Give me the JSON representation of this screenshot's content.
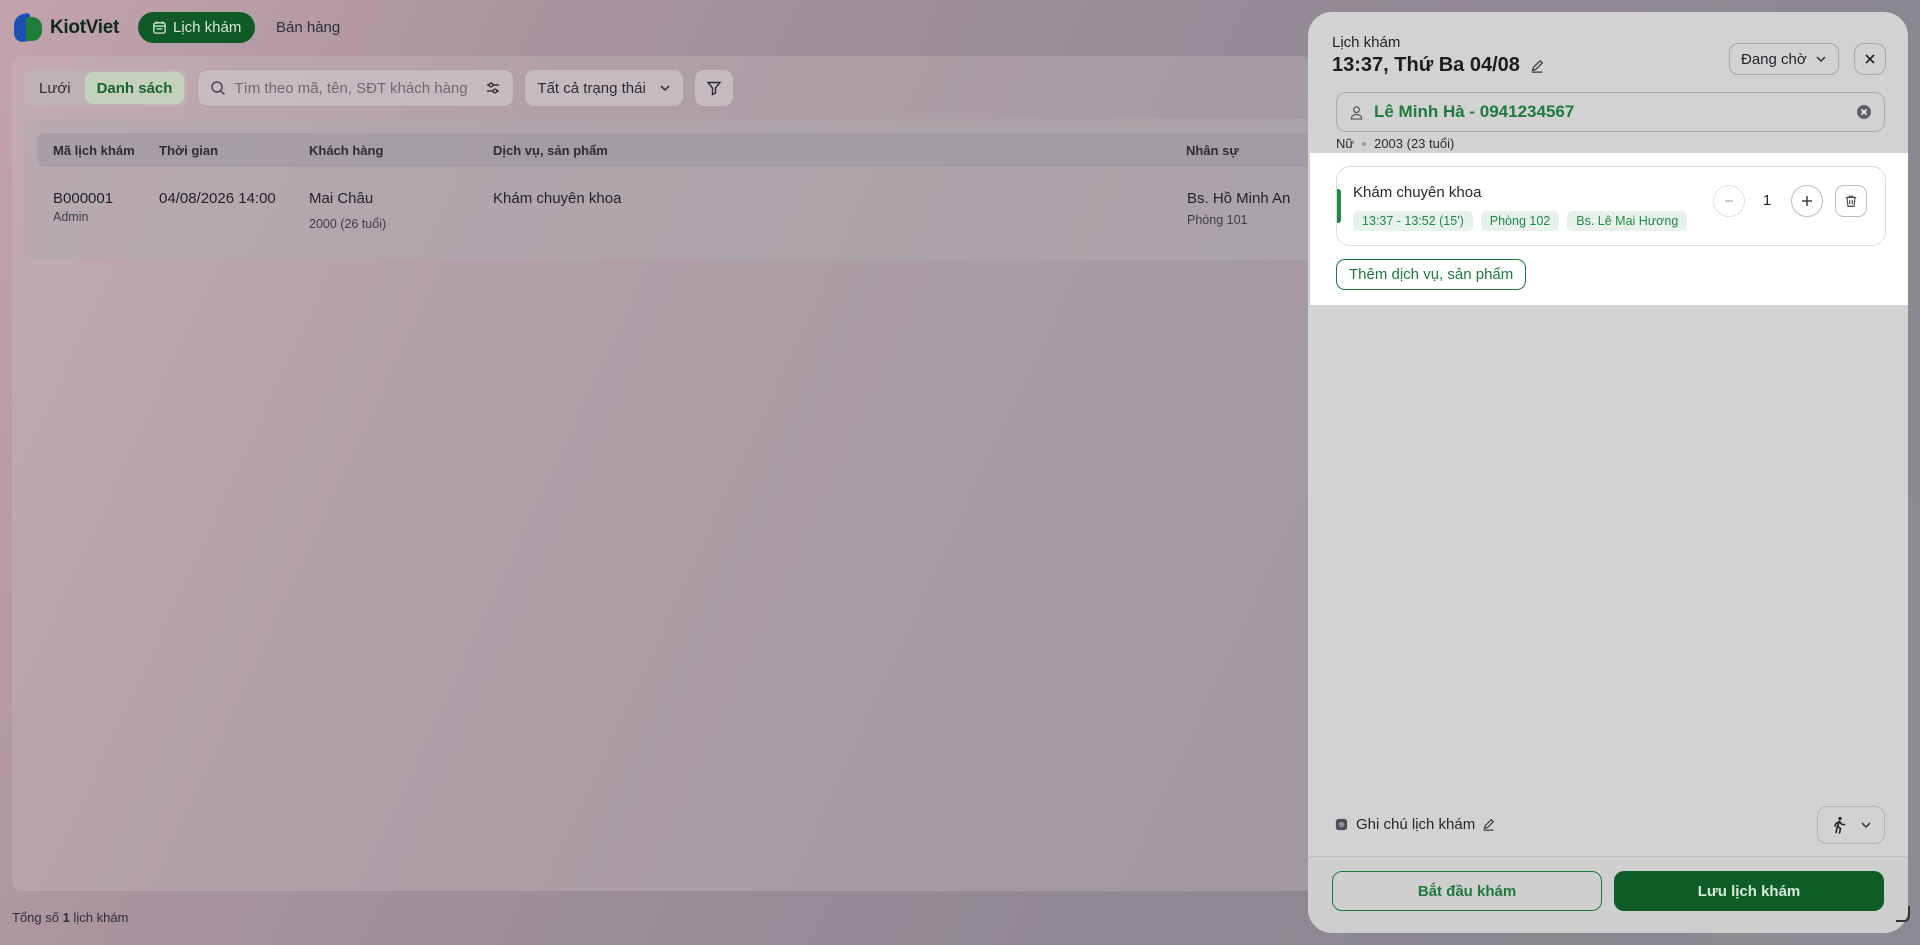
{
  "app": {
    "name": "KiotViet",
    "nav": [
      {
        "label": "Lịch khám",
        "active": true
      },
      {
        "label": "Bán hàng",
        "active": false
      }
    ]
  },
  "toolbar": {
    "views": [
      {
        "label": "Lưới",
        "active": false
      },
      {
        "label": "Danh sách",
        "active": true
      }
    ],
    "search_placeholder": "Tìm theo mã, tên, SĐT khách hàng",
    "status_filter": "Tất cả trạng thái"
  },
  "table": {
    "headers": [
      "Mã lịch khám",
      "Thời gian",
      "Khách hàng",
      "Dịch vụ, sản phẩm",
      "Nhân sự"
    ],
    "rows": [
      {
        "code": "B000001",
        "creator": "Admin",
        "time": "04/08/2026 14:00",
        "customer": "Mai Châu",
        "customer_meta": "2000 (26 tuổi)",
        "service": "Khám chuyên khoa",
        "staff": "Bs. Hồ Minh An",
        "room": "Phòng 101"
      }
    ]
  },
  "footer": {
    "prefix": "Tổng số",
    "count": "1",
    "suffix": "lịch khám"
  },
  "drawer": {
    "label": "Lịch khám",
    "datetime": "13:37, Thứ Ba 04/08",
    "status": "Đang chờ",
    "customer": {
      "name": "Lê Minh Hà - 0941234567",
      "gender": "Nữ",
      "birth": "2003 (23 tuổi)"
    },
    "service": {
      "name": "Khám chuyên khoa",
      "time": "13:37 - 13:52 (15')",
      "room": "Phòng 102",
      "doctor": "Bs. Lê Mai Hương",
      "quantity": "1"
    },
    "add_service_label": "Thêm dịch vụ, sản phẩm",
    "note_label": "Ghi chú lịch khám",
    "start_label": "Bắt đầu khám",
    "save_label": "Lưu lịch khám"
  },
  "colors": {
    "brand_green": "#0e5d27",
    "accent_green": "#1e7a3d",
    "chip_bg": "#e8f2eb"
  },
  "icons": [
    "calendar-icon",
    "search-icon",
    "sliders-icon",
    "chevron-down-icon",
    "funnel-icon",
    "pencil-icon",
    "close-icon",
    "user-icon",
    "clear-icon",
    "minus-icon",
    "plus-icon",
    "trash-icon",
    "note-icon",
    "walking-icon"
  ]
}
